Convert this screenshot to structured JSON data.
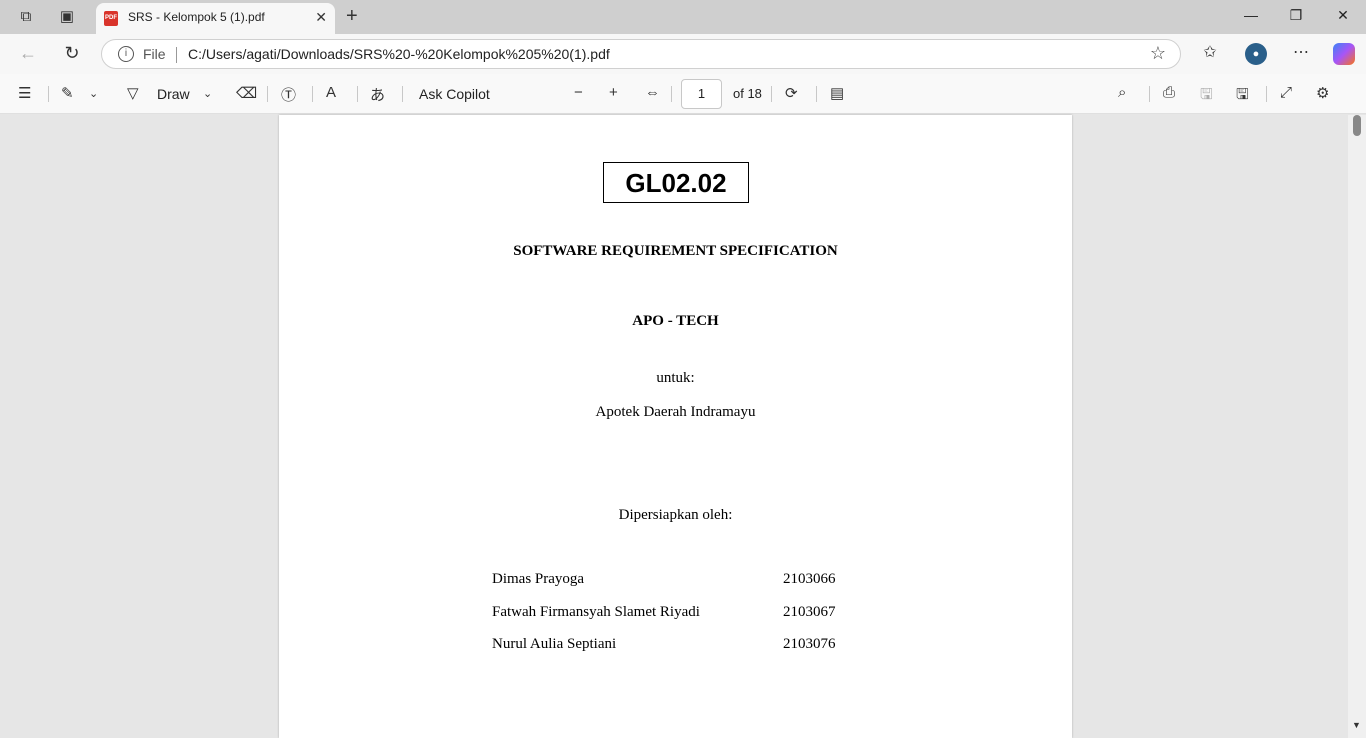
{
  "browser": {
    "tab": {
      "title": "SRS - Kelompok 5 (1).pdf",
      "icon": "pdf-icon"
    },
    "address": {
      "scheme_label": "File",
      "url": "C:/Users/agati/Downloads/SRS%20-%20Kelompok%205%20(1).pdf"
    }
  },
  "pdf_toolbar": {
    "draw_label": "Draw",
    "ask_copilot_label": "Ask Copilot",
    "page_current": "1",
    "page_total": "of 18"
  },
  "document": {
    "code": "GL02.02",
    "title": "SOFTWARE REQUIREMENT SPECIFICATION",
    "product": "APO - TECH",
    "for_label": "untuk:",
    "client": "Apotek Daerah Indramayu",
    "prepared_by": "Dipersiapkan oleh:",
    "authors": [
      {
        "name": "Dimas Prayoga",
        "nim": "2103066"
      },
      {
        "name": "Fatwah Firmansyah Slamet Riyadi",
        "nim": "2103067"
      },
      {
        "name": "Nurul Aulia Septiani",
        "nim": "2103076"
      }
    ]
  }
}
